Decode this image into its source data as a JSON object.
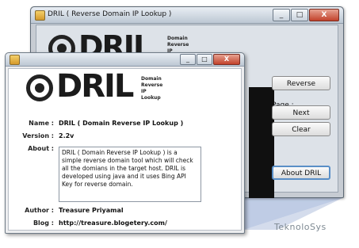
{
  "main_window": {
    "title": "DRIL ( Reverse Domain IP Lookup )",
    "logo_word": "DRIL",
    "logo_sub": "Domain\nReverse\nIP",
    "buttons": {
      "reverse": "Reverse",
      "next": "Next",
      "clear": "Clear",
      "about": "About DRIL"
    },
    "page_label": "Page :"
  },
  "about_dialog": {
    "logo_word": "DRIL",
    "logo_sub": "Domain\nReverse\nIP\nLookup",
    "fields": {
      "name_label": "Name :",
      "name_value": "DRIL ( Domain Reverse IP Lookup )",
      "version_label": "Version :",
      "version_value": "2.2v",
      "about_label": "About :",
      "about_text": "DRIL ( Domain Reverse IP Lookup ) is a simple reverse domain tool which will check all the domians in the target host. DRIL is developed using java and it uses Bing API Key for reverse domain.",
      "author_label": "Author :",
      "author_value": "Treasure Priyamal",
      "blog_label": "Blog :",
      "blog_value": "http://treasure.blogetery.com/"
    }
  },
  "window_controls": {
    "minimize": "_",
    "maximize": "□",
    "close": "X"
  },
  "watermark": "TeknoloSys"
}
